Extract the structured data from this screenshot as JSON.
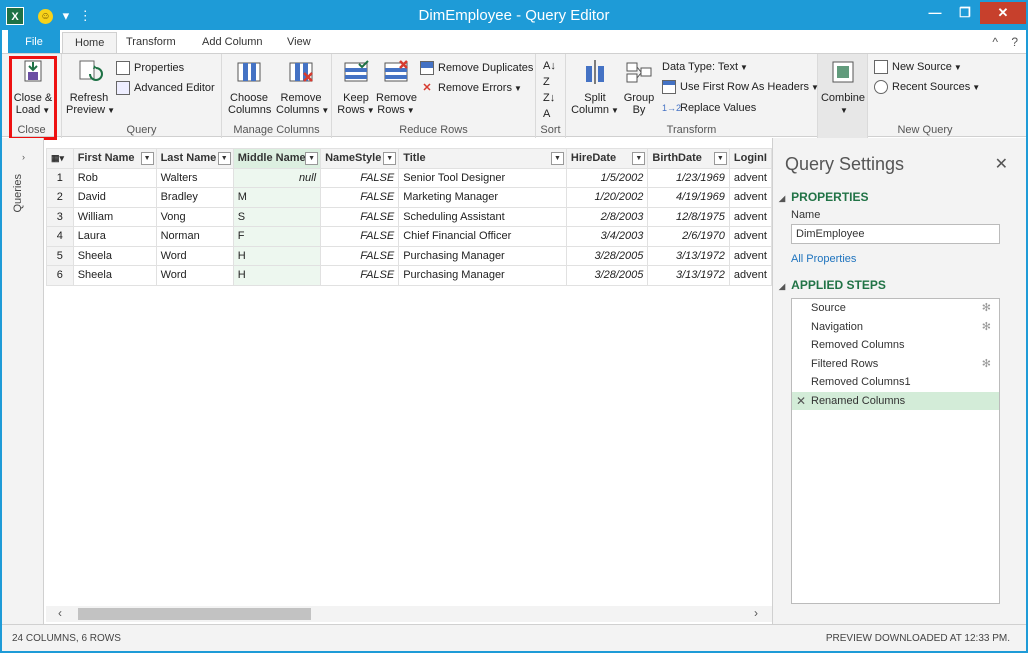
{
  "window": {
    "title": "DimEmployee - Query Editor",
    "app_icon": "X",
    "qat_customize": "▾",
    "minimize": "—",
    "maximize": "□",
    "restore_down": "❐",
    "close": "✕"
  },
  "tabs": {
    "file": "File",
    "items": [
      "Home",
      "Transform",
      "Add Column",
      "View"
    ],
    "active": "Home",
    "collapse_ribbon": "^",
    "help": "?"
  },
  "ribbon": {
    "close": {
      "button_line1": "Close &",
      "button_line2": "Load",
      "label": "Close"
    },
    "query": {
      "refresh_line1": "Refresh",
      "refresh_line2": "Preview",
      "properties": "Properties",
      "advanced_editor": "Advanced Editor",
      "label": "Query"
    },
    "manage_columns": {
      "choose_line1": "Choose",
      "choose_line2": "Columns",
      "remove_line1": "Remove",
      "remove_line2": "Columns",
      "label": "Manage Columns"
    },
    "reduce_rows": {
      "keep_line1": "Keep",
      "keep_line2": "Rows",
      "remove_line1": "Remove",
      "remove_line2": "Rows",
      "remove_duplicates": "Remove Duplicates",
      "remove_errors": "Remove Errors",
      "label": "Reduce Rows"
    },
    "sort": {
      "label": "Sort"
    },
    "transform": {
      "split_line1": "Split",
      "split_line2": "Column",
      "group_line1": "Group",
      "group_line2": "By",
      "data_type": "Data Type: Text",
      "first_row_headers": "Use First Row As Headers",
      "replace_values": "Replace Values",
      "label": "Transform"
    },
    "combine": {
      "button": "Combine"
    },
    "new_query": {
      "new_source": "New Source",
      "recent_sources": "Recent Sources",
      "label": "New Query"
    }
  },
  "queries_pane": {
    "label": "Queries",
    "expand_arrow": "›"
  },
  "grid": {
    "columns": [
      "First Name",
      "Last Name",
      "Middle Name",
      "NameStyle",
      "Title",
      "HireDate",
      "BirthDate",
      "LoginI"
    ],
    "selected_column": "Middle Name",
    "rows": [
      {
        "n": "1",
        "first": "Rob",
        "last": "Walters",
        "middle": "null",
        "style": "FALSE",
        "title": "Senior Tool Designer",
        "hire": "1/5/2002",
        "birth": "1/23/1969",
        "login": "advent"
      },
      {
        "n": "2",
        "first": "David",
        "last": "Bradley",
        "middle": "M",
        "style": "FALSE",
        "title": "Marketing Manager",
        "hire": "1/20/2002",
        "birth": "4/19/1969",
        "login": "advent"
      },
      {
        "n": "3",
        "first": "William",
        "last": "Vong",
        "middle": "S",
        "style": "FALSE",
        "title": "Scheduling Assistant",
        "hire": "2/8/2003",
        "birth": "12/8/1975",
        "login": "advent"
      },
      {
        "n": "4",
        "first": "Laura",
        "last": "Norman",
        "middle": "F",
        "style": "FALSE",
        "title": "Chief Financial Officer",
        "hire": "3/4/2003",
        "birth": "2/6/1970",
        "login": "advent"
      },
      {
        "n": "5",
        "first": "Sheela",
        "last": "Word",
        "middle": "H",
        "style": "FALSE",
        "title": "Purchasing Manager",
        "hire": "3/28/2005",
        "birth": "3/13/1972",
        "login": "advent"
      },
      {
        "n": "6",
        "first": "Sheela",
        "last": "Word",
        "middle": "H",
        "style": "FALSE",
        "title": "Purchasing Manager",
        "hire": "3/28/2005",
        "birth": "3/13/1972",
        "login": "advent"
      }
    ],
    "scroll_left": "‹",
    "scroll_right": "›"
  },
  "query_settings": {
    "title": "Query Settings",
    "close": "✕",
    "properties_heading": "PROPERTIES",
    "name_label": "Name",
    "name_value": "DimEmployee",
    "all_properties": "All Properties",
    "applied_steps_heading": "APPLIED STEPS",
    "steps": [
      {
        "label": "Source",
        "gear": "✻"
      },
      {
        "label": "Navigation",
        "gear": "✻"
      },
      {
        "label": "Removed Columns",
        "gear": ""
      },
      {
        "label": "Filtered Rows",
        "gear": "✻"
      },
      {
        "label": "Removed Columns1",
        "gear": ""
      },
      {
        "label": "Renamed Columns",
        "gear": ""
      }
    ],
    "active_step": "Renamed Columns"
  },
  "status": {
    "left": "24 COLUMNS, 6 ROWS",
    "right": "PREVIEW DOWNLOADED AT 12:33 PM."
  },
  "colors": {
    "title_bar": "#1e9bd7",
    "accent_green": "#217346",
    "highlight_red": "#ee1111"
  }
}
